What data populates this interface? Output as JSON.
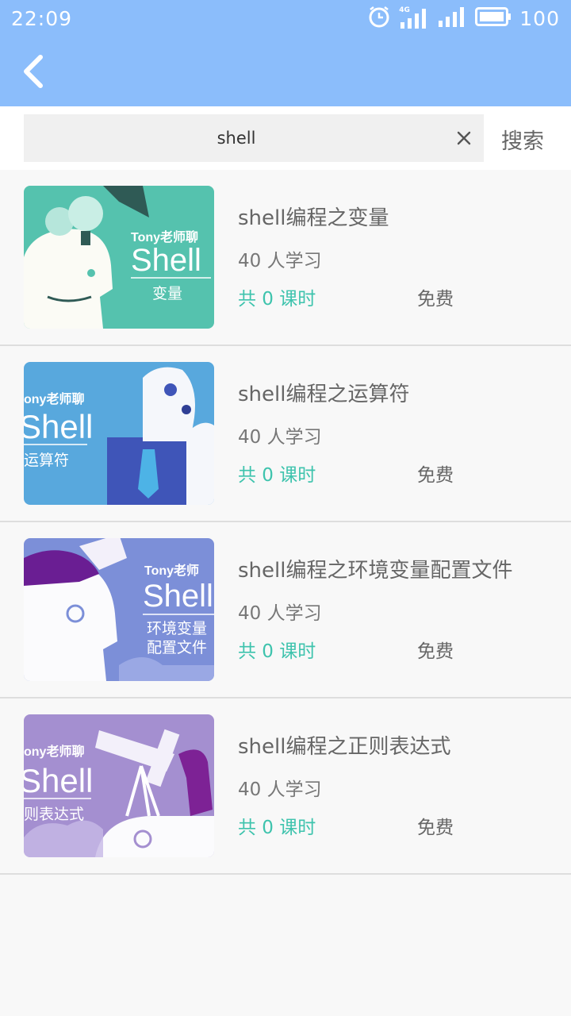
{
  "status": {
    "time": "22:09",
    "network": "4G",
    "battery": "100"
  },
  "search": {
    "query": "shell",
    "button_label": "搜索"
  },
  "courses": [
    {
      "title": "shell编程之变量",
      "students": "40 人学习",
      "lessons": "共 0 课时",
      "price": "免费",
      "thumb": {
        "brand": "Tony老师聊",
        "word": "Shell",
        "caption": "变量",
        "bg": "#55c2ae"
      }
    },
    {
      "title": "shell编程之运算符",
      "students": "40 人学习",
      "lessons": "共 0 课时",
      "price": "免费",
      "thumb": {
        "brand": "ony老师聊",
        "word": "Shell",
        "caption": "运算符",
        "bg": "#58a8dd"
      }
    },
    {
      "title": "shell编程之环境变量配置文件",
      "students": "40 人学习",
      "lessons": "共 0 课时",
      "price": "免费",
      "thumb": {
        "brand": "Tony老师",
        "word": "Shell",
        "caption": "环境变量",
        "caption2": "配置文件",
        "bg": "#7c8fd8"
      }
    },
    {
      "title": "shell编程之正则表达式",
      "students": "40 人学习",
      "lessons": "共 0 课时",
      "price": "免费",
      "thumb": {
        "brand": "ony老师聊",
        "word": "Shell",
        "caption": "则表达式",
        "bg": "#a48fd0"
      }
    }
  ],
  "colors": {
    "header": "#8bbdfb",
    "accent": "#3ec3ad"
  }
}
